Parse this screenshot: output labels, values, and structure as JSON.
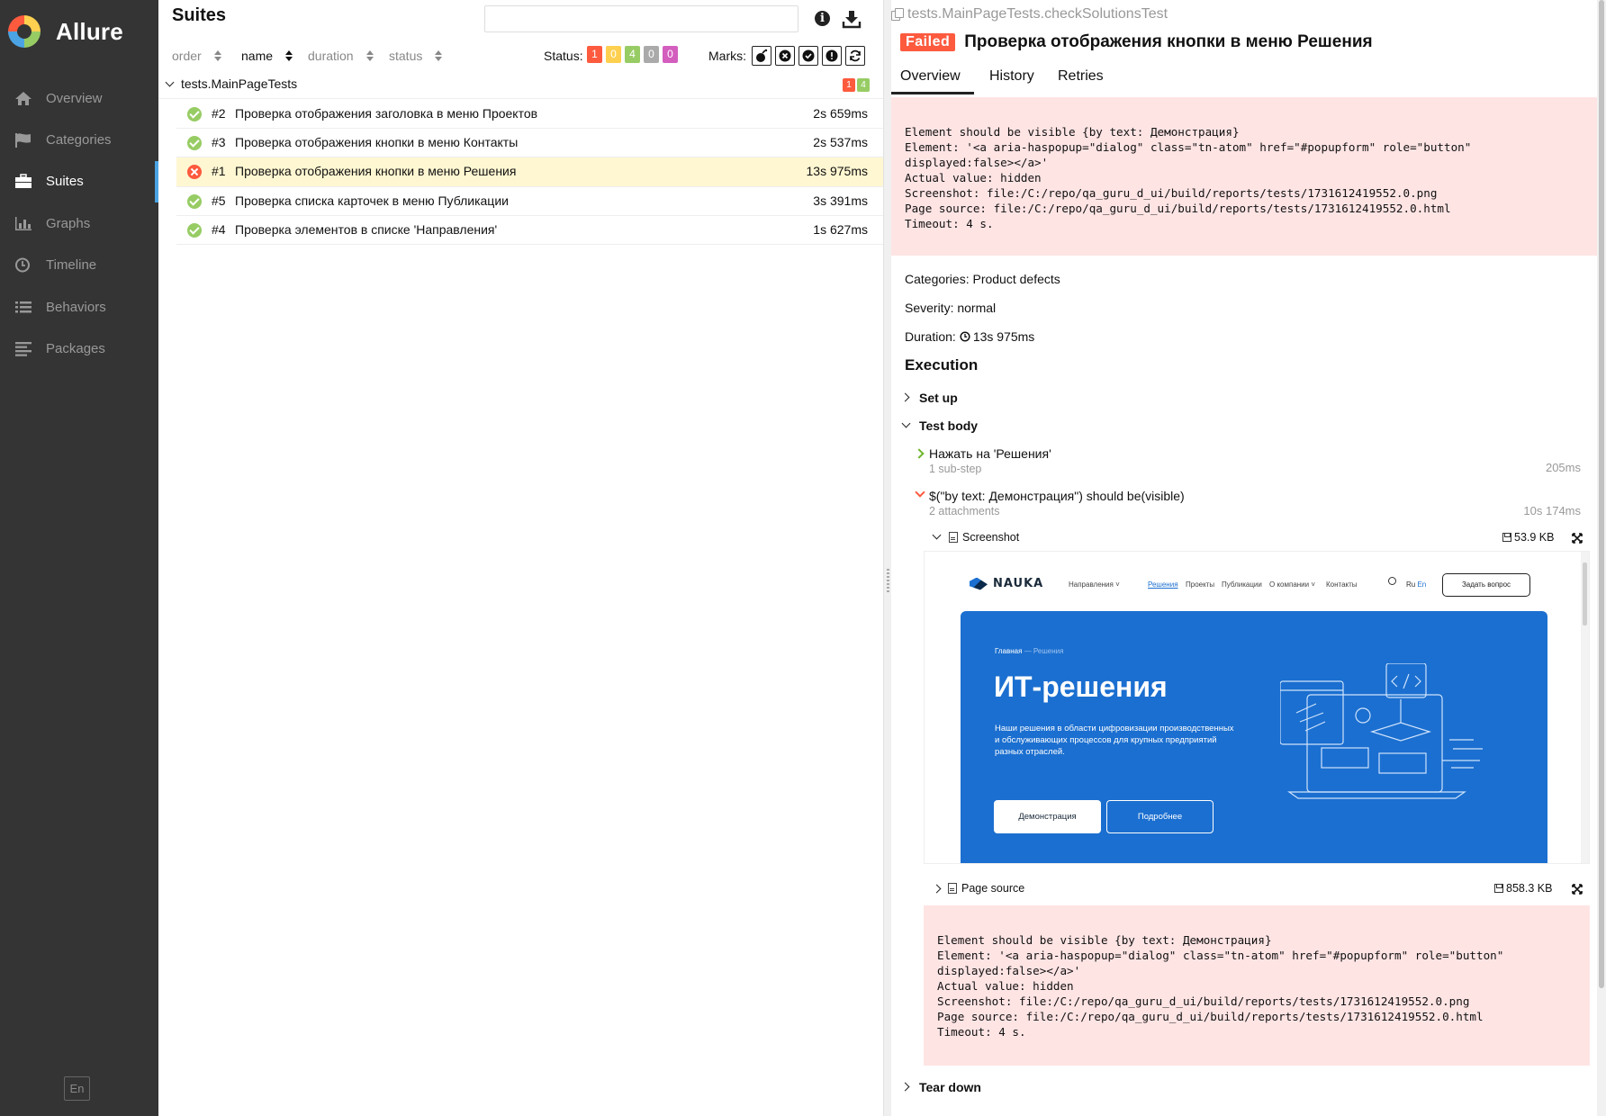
{
  "app": {
    "name": "Allure"
  },
  "sidebar": {
    "items": [
      {
        "label": "Overview",
        "icon": "home-icon"
      },
      {
        "label": "Categories",
        "icon": "flag-icon"
      },
      {
        "label": "Suites",
        "icon": "briefcase-icon"
      },
      {
        "label": "Graphs",
        "icon": "bar-chart-icon"
      },
      {
        "label": "Timeline",
        "icon": "clock-icon"
      },
      {
        "label": "Behaviors",
        "icon": "list-icon"
      },
      {
        "label": "Packages",
        "icon": "align-left-icon"
      }
    ],
    "active": "Suites",
    "language": "En"
  },
  "suites": {
    "title": "Suites",
    "search_value": "",
    "sort": [
      {
        "label": "order",
        "active": false
      },
      {
        "label": "name",
        "active": true
      },
      {
        "label": "duration",
        "active": false
      },
      {
        "label": "status",
        "active": false
      }
    ],
    "status_label": "Status:",
    "status_counts": [
      {
        "value": "1",
        "color": "#fd5a3e"
      },
      {
        "value": "0",
        "color": "#ffd050"
      },
      {
        "value": "4",
        "color": "#97cc64"
      },
      {
        "value": "0",
        "color": "#aaaaaa"
      },
      {
        "value": "0",
        "color": "#d35ebe"
      }
    ],
    "marks_label": "Marks:",
    "group": {
      "name": "tests.MainPageTests",
      "counts": [
        {
          "value": "1",
          "color": "#fd5a3e"
        },
        {
          "value": "4",
          "color": "#97cc64"
        }
      ]
    },
    "tests": [
      {
        "num": "#2",
        "name": "Проверка отображения заголовка в меню Проектов",
        "duration": "2s 659ms",
        "status": "passed"
      },
      {
        "num": "#3",
        "name": "Проверка отображения кнопки в меню Контакты",
        "duration": "2s 537ms",
        "status": "passed"
      },
      {
        "num": "#1",
        "name": "Проверка отображения кнопки в меню Решения",
        "duration": "13s 975ms",
        "status": "failed"
      },
      {
        "num": "#5",
        "name": "Проверка списка карточек в меню Публикации",
        "duration": "3s 391ms",
        "status": "passed"
      },
      {
        "num": "#4",
        "name": "Проверка элементов в списке 'Направления'",
        "duration": "1s 627ms",
        "status": "passed"
      }
    ]
  },
  "detail": {
    "breadcrumb": "tests.MainPageTests.checkSolutionsTest",
    "status_badge": "Failed",
    "title": "Проверка отображения кнопки в меню Решения",
    "tabs": [
      "Overview",
      "History",
      "Retries"
    ],
    "error": "Element should be visible {by text: Демонстрация}\nElement: '<a aria-haspopup=\"dialog\" class=\"tn-atom\" href=\"#popupform\" role=\"button\"\ndisplayed:false></a>'\nActual value: hidden\nScreenshot: file:/C:/repo/qa_guru_d_ui/build/reports/tests/1731612419552.0.png\nPage source: file:/C:/repo/qa_guru_d_ui/build/reports/tests/1731612419552.0.html\nTimeout: 4 s.",
    "categories": "Categories: Product defects",
    "severity": "Severity: normal",
    "duration_label": "Duration:",
    "duration": "13s 975ms",
    "execution_title": "Execution",
    "setup": "Set up",
    "test_body": "Test body",
    "teardown": "Tear down",
    "steps": [
      {
        "name": "Нажать на 'Решения'",
        "sub": "1 sub-step",
        "time": "205ms"
      },
      {
        "name": "$(\"by text: Демонстрация\") should be(visible)",
        "sub": "2 attachments",
        "time": "10s 174ms"
      }
    ],
    "attachments": [
      {
        "name": "Screenshot",
        "size": "53.9 KB"
      },
      {
        "name": "Page source",
        "size": "858.3 KB"
      }
    ],
    "screenshot": {
      "logo": "NAUKA",
      "menu": [
        "Направления ˅",
        "Решения",
        "Проекты",
        "Публикации",
        "О компании ˅",
        "Контакты"
      ],
      "lang_ru": "Ru",
      "lang_en": "En",
      "ask_button": "Задать вопрос",
      "crumb_home": "Главная",
      "crumb_current": "— Решения",
      "hero_title": "ИТ-решения",
      "hero_text": "Наши решения в области цифровизации производственных и обслуживающих процессов для крупных предприятий разных отраслей.",
      "button_demo": "Демонстрация",
      "button_more": "Подробнее"
    }
  }
}
